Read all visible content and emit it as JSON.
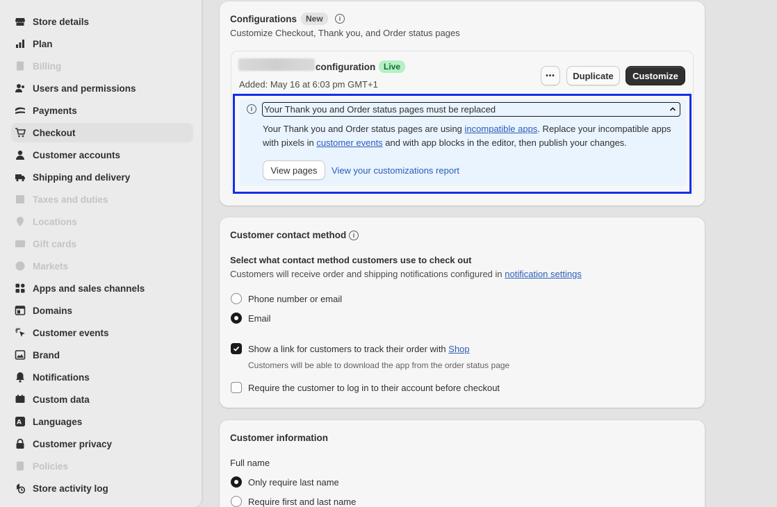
{
  "sidebar": {
    "items": [
      {
        "label": "Store details",
        "icon": "store-icon",
        "disabled": false
      },
      {
        "label": "Plan",
        "icon": "plan-icon",
        "disabled": false
      },
      {
        "label": "Billing",
        "icon": "billing-icon",
        "disabled": true
      },
      {
        "label": "Users and permissions",
        "icon": "users-icon",
        "disabled": false
      },
      {
        "label": "Payments",
        "icon": "payments-icon",
        "disabled": false
      },
      {
        "label": "Checkout",
        "icon": "cart-icon",
        "disabled": false,
        "active": true
      },
      {
        "label": "Customer accounts",
        "icon": "person-icon",
        "disabled": false
      },
      {
        "label": "Shipping and delivery",
        "icon": "truck-icon",
        "disabled": false
      },
      {
        "label": "Taxes and duties",
        "icon": "taxes-icon",
        "disabled": true
      },
      {
        "label": "Locations",
        "icon": "location-icon",
        "disabled": true
      },
      {
        "label": "Gift cards",
        "icon": "gift-card-icon",
        "disabled": true
      },
      {
        "label": "Markets",
        "icon": "globe-icon",
        "disabled": true
      },
      {
        "label": "Apps and sales channels",
        "icon": "apps-icon",
        "disabled": false
      },
      {
        "label": "Domains",
        "icon": "domains-icon",
        "disabled": false
      },
      {
        "label": "Customer events",
        "icon": "cursor-icon",
        "disabled": false
      },
      {
        "label": "Brand",
        "icon": "brand-icon",
        "disabled": false
      },
      {
        "label": "Notifications",
        "icon": "bell-icon",
        "disabled": false
      },
      {
        "label": "Custom data",
        "icon": "custom-data-icon",
        "disabled": false
      },
      {
        "label": "Languages",
        "icon": "languages-icon",
        "disabled": false
      },
      {
        "label": "Customer privacy",
        "icon": "lock-icon",
        "disabled": false
      },
      {
        "label": "Policies",
        "icon": "policies-icon",
        "disabled": true
      },
      {
        "label": "Store activity log",
        "icon": "activity-icon",
        "disabled": false
      }
    ]
  },
  "configurations": {
    "title": "Configurations",
    "badge": "New",
    "subtitle": "Customize Checkout, Thank you, and Order status pages",
    "config": {
      "name_suffix": "configuration",
      "status": "Live",
      "added": "Added: May 16 at 6:03 pm GMT+1",
      "more_label": "•••",
      "duplicate_label": "Duplicate",
      "customize_label": "Customize"
    },
    "banner": {
      "title": "Your Thank you and Order status pages must be replaced",
      "text_1": "Your Thank you and Order status pages are using ",
      "link_1": "incompatible apps",
      "text_2": ". Replace your incompatible apps with pixels in ",
      "link_2": "customer events",
      "text_3": " and with app blocks in the editor, then publish your changes.",
      "view_pages_label": "View pages",
      "report_link": "View your customizations report"
    }
  },
  "contact_method": {
    "title": "Customer contact method",
    "question": "Select what contact method customers use to check out",
    "desc": "Customers will receive order and shipping notifications configured in ",
    "desc_link": "notification settings",
    "options": [
      "Phone number or email",
      "Email"
    ],
    "selected": "Email",
    "track_label": "Show a link for customers to track their order with ",
    "track_link": "Shop",
    "track_checked": true,
    "track_help": "Customers will be able to download the app from the order status page",
    "login_label": "Require the customer to log in to their account before checkout",
    "login_checked": false
  },
  "customer_info": {
    "title": "Customer information",
    "full_name_label": "Full name",
    "options": [
      "Only require last name",
      "Require first and last name"
    ],
    "selected": "Only require last name"
  }
}
